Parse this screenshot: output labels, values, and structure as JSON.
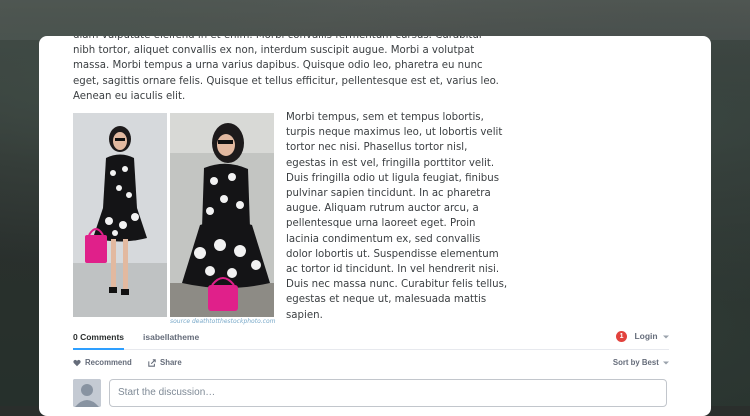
{
  "article": {
    "para1": "diam vulputate eleifend in et enim. Morbi convallis fermentum cursus. Curabitur nibh tortor, aliquet convallis ex non, interdum suscipit augue. Morbi a volutpat massa. Morbi tempus a urna varius dapibus. Quisque odio leo, pharetra eu nunc eget, sagittis ornare felis. Quisque et tellus efficitur, pellentesque est et, varius leo. Aenean eu iaculis elit.",
    "para2": "Morbi tempus, sem et tempus lobortis, turpis neque maximus leo, ut lobortis velit tortor nec nisi. Phasellus tortor nisl, egestas in est vel, fringilla porttitor velit. Duis fringilla odio ut ligula feugiat, finibus pulvinar sapien tincidunt. In ac pharetra augue. Aliquam rutrum auctor arcu, a pellentesque urna laoreet eget. Proin lacinia condimentum ex, sed convallis dolor lobortis ut. Suspendisse elementum ac tortor id tincidunt. In vel hendrerit nisi. Duis nec massa nunc. Curabitur felis tellus, egestas et neque ut, malesuada mattis sapien.",
    "photo_caption": "source deathtotthestockphoto.com"
  },
  "comments": {
    "tab_comments": "0 Comments",
    "tab_forum": "isabellatheme",
    "notification_count": "1",
    "login_label": "Login",
    "recommend_label": "Recommend",
    "share_label": "Share",
    "sort_label": "Sort by Best",
    "input_placeholder": "Start the discussion…"
  },
  "colors": {
    "accent": "#2e9fff",
    "badge": "#e2423d",
    "caption": "#79a9c9"
  }
}
